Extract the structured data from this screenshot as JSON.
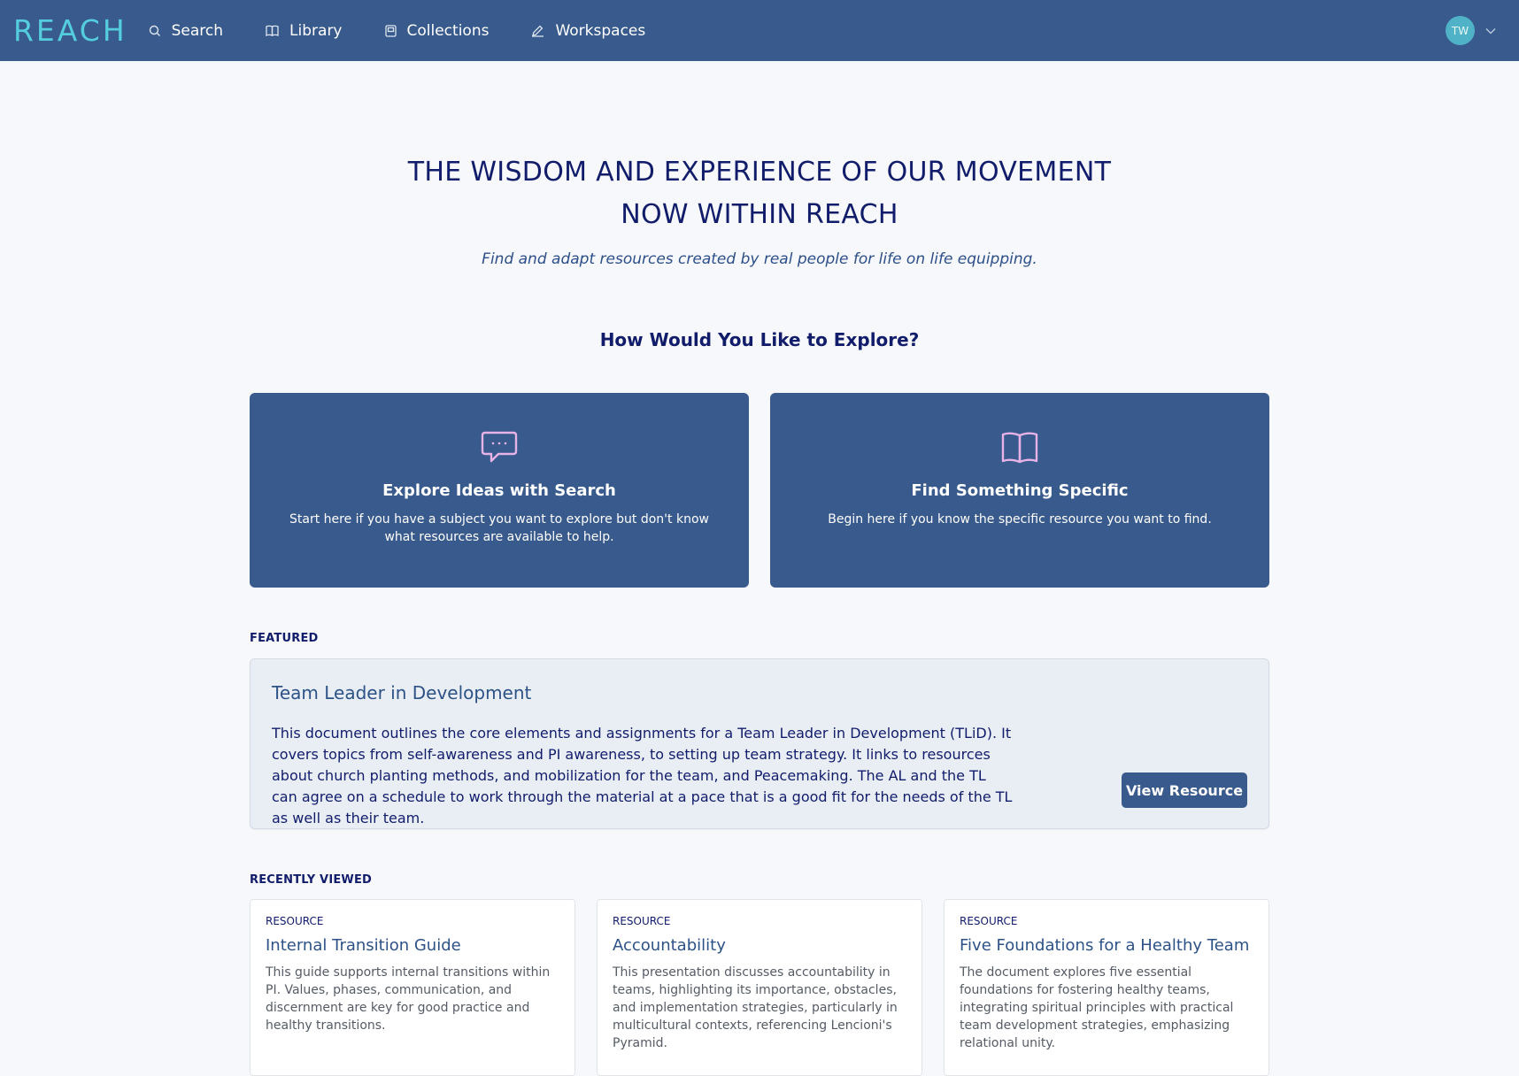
{
  "nav": {
    "logo": "REACH",
    "items": [
      {
        "label": "Search",
        "icon": "search-icon"
      },
      {
        "label": "Library",
        "icon": "book-icon"
      },
      {
        "label": "Collections",
        "icon": "collection-icon"
      },
      {
        "label": "Workspaces",
        "icon": "edit-icon"
      }
    ],
    "user_initials": "TW"
  },
  "hero": {
    "title_line1": "THE WISDOM AND EXPERIENCE OF OUR MOVEMENT",
    "title_line2": "NOW WITHIN REACH",
    "subtitle": "Find and adapt resources created by real people for life on life equipping."
  },
  "explore": {
    "heading": "How Would You Like to Explore?",
    "cards": [
      {
        "title": "Explore Ideas with Search",
        "description": "Start here if you have a subject you want to explore but don't know what resources are available to help.",
        "icon": "chat-bubble-icon"
      },
      {
        "title": "Find Something Specific",
        "description": "Begin here if you know the specific resource you want to find.",
        "icon": "open-book-icon"
      }
    ]
  },
  "featured": {
    "label": "FEATURED",
    "title": "Team Leader in Development",
    "description": "This document outlines the core elements and assignments for a Team Leader in Development (TLiD). It covers topics from self-awareness and PI awareness, to setting up team strategy. It links to resources about church planting methods, and mobilization for the team, and Peacemaking. The AL and the TL can agree on a schedule to work through the material at a pace that is a good fit for the needs of the TL as well as their team.",
    "button_label": "View Resource"
  },
  "recent": {
    "label": "RECENTLY VIEWED",
    "items": [
      {
        "type": "RESOURCE",
        "title": "Internal Transition Guide",
        "description": "This guide supports internal transitions within PI. Values, phases, communication, and discernment are key for good practice and healthy transitions."
      },
      {
        "type": "RESOURCE",
        "title": "Accountability",
        "description": "This presentation discusses accountability in teams, highlighting its importance, obstacles, and implementation strategies, particularly in multicultural contexts, referencing Lencioni's Pyramid."
      },
      {
        "type": "RESOURCE",
        "title": "Five Foundations for a Healthy Team",
        "description": "The document explores five essential foundations for fostering healthy teams, integrating spiritual principles with practical team development strategies, emphasizing relational unity."
      }
    ]
  },
  "colors": {
    "navbar": "#385a8c",
    "logo": "#56d4e3",
    "heading": "#111c6b",
    "accent_icon": "#e7b3e6"
  }
}
